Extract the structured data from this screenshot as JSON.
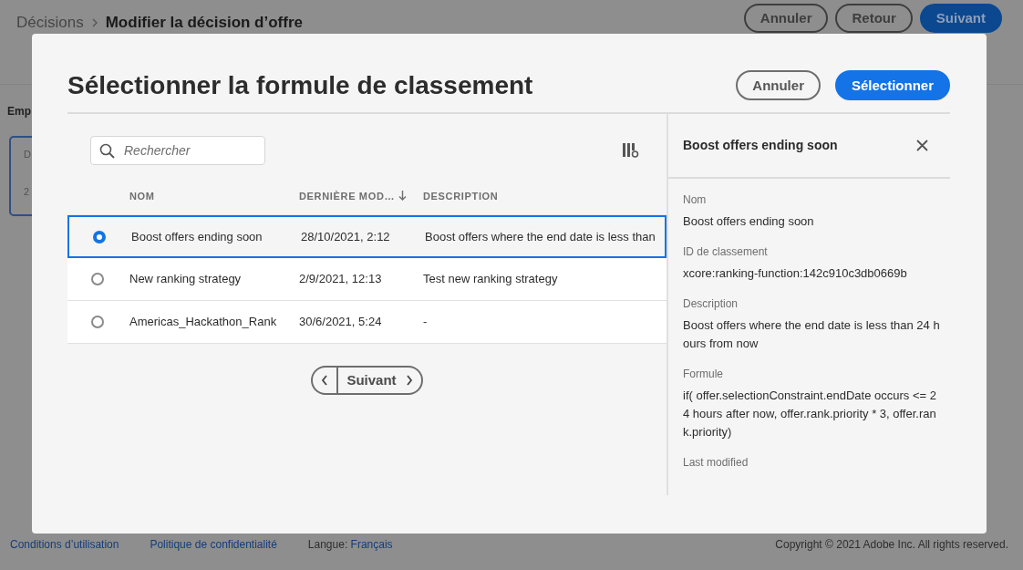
{
  "breadcrumb": {
    "parent": "Décisions",
    "current": "Modifier la décision d’offre"
  },
  "header_buttons": [
    {
      "label": "Annuler",
      "kind": "outline"
    },
    {
      "label": "Retour",
      "kind": "outline"
    },
    {
      "label": "Suivant",
      "kind": "primary"
    }
  ],
  "background": {
    "section_label": "Emp",
    "card_lines": [
      "D",
      "2"
    ]
  },
  "dialog": {
    "title": "Sélectionner la formule de classement",
    "buttons": [
      {
        "label": "Annuler",
        "kind": "outline"
      },
      {
        "label": "Sélectionner",
        "kind": "primary"
      }
    ],
    "search": {
      "placeholder": "Rechercher"
    },
    "table": {
      "columns": [
        {
          "label": "NOM",
          "sorted": false
        },
        {
          "label": "DERNIÈRE MOD…",
          "sorted": true
        },
        {
          "label": "DESCRIPTION",
          "sorted": false
        }
      ],
      "rows": [
        {
          "selected": true,
          "name": "Boost offers ending soon",
          "modified": "28/10/2021, 2:12",
          "description": "Boost offers where the end date is less than"
        },
        {
          "selected": false,
          "name": "New ranking strategy",
          "modified": "2/9/2021, 12:13",
          "description": "Test new ranking strategy"
        },
        {
          "selected": false,
          "name": "Americas_Hackathon_Rank",
          "modified": "30/6/2021, 5:24",
          "description": "-"
        }
      ]
    },
    "pagination": {
      "next_label": "Suivant"
    },
    "detail": {
      "title": "Boost offers ending soon",
      "fields": [
        {
          "label": "Nom",
          "value": "Boost offers ending soon"
        },
        {
          "label": "ID de classement",
          "value": "xcore:ranking-function:142c910c3db0669b"
        },
        {
          "label": "Description",
          "value": "Boost offers where the end date is less than 24 hours from now"
        },
        {
          "label": "Formule",
          "value": "if( offer.selectionConstraint.endDate occurs <= 24 hours after now, offer.rank.priority * 3, offer.rank.priority)"
        },
        {
          "label": "Last modified"
        }
      ]
    }
  },
  "footer": {
    "links": [
      "Conditions d’utilisation",
      "Politique de confidentialité"
    ],
    "language_label": "Langue:",
    "language": "Français",
    "copyright": "Copyright ©  2021 Adobe Inc.  All rights reserved."
  }
}
